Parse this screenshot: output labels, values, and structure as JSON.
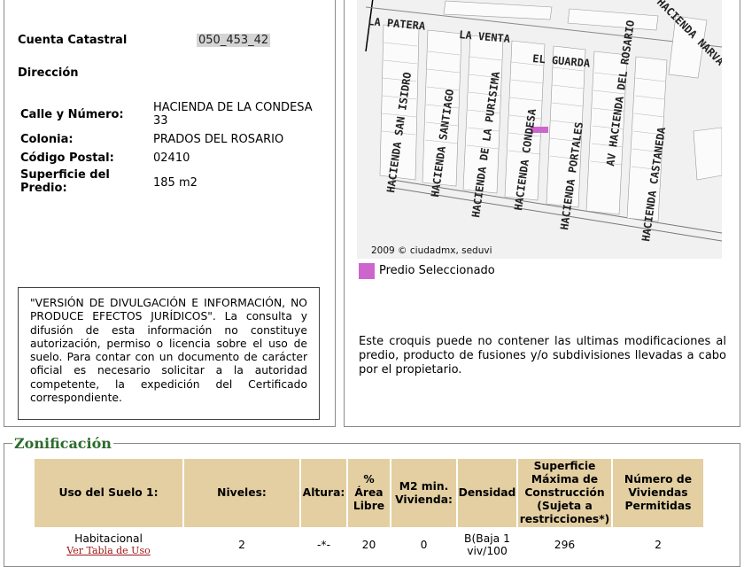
{
  "predio": {
    "cuenta_label": "Cuenta Catastral",
    "cuenta_value": "050_453_42",
    "direccion_label": "Dirección",
    "address": [
      {
        "label": "Calle y Número:",
        "value": "HACIENDA DE LA CONDESA 33"
      },
      {
        "label": "Colonia:",
        "value": "PRADOS DEL ROSARIO"
      },
      {
        "label": "Código Postal:",
        "value": "02410"
      },
      {
        "label": "Superficie del Predio:",
        "value": "185 m2"
      }
    ],
    "disclaimer": "\"VERSIÓN DE DIVULGACIÓN E INFORMACIÓN, NO PRODUCE EFECTOS JURÍDICOS\". La consulta y difusión de esta información no constituye autorización, permiso o licencia sobre el uso de suelo. Para contar con un documento de carácter oficial es necesario solicitar a la autoridad competente, la expedición del Certificado correspondiente."
  },
  "map": {
    "streets": [
      "LA PATERA",
      "LA VENTA",
      "EL GUARDA",
      "HACIENDA NARVA",
      "HACIENDA SAN ISIDRO",
      "HACIENDA SANTIAGO",
      "HACIENDA DE LA PURISIMA",
      "HACIENDA CONDESA",
      "HACIENDA PORTALES",
      "AV HACIENDA DEL ROSARIO",
      "HACIENDA CASTANEDA"
    ],
    "footer": "2009 © ciudadmx, seduvi",
    "legend_label": "Predio Seleccionado",
    "highlight_color": "#cc66cc",
    "note": "Este croquis puede no contener las ultimas modificaciones al predio, producto de fusiones y/o subdivisiones llevadas a cabo por el propietario."
  },
  "zonificacion": {
    "title": "Zonificación",
    "headers": [
      "Uso del Suelo 1:",
      "Niveles:",
      "Altura:",
      "% Área Libre",
      "M2 min. Vivienda:",
      "Densidad",
      "Superficie Máxima de Construcción (Sujeta a restricciones*)",
      "Número de Viviendas Permitidas"
    ],
    "row": {
      "uso": "Habitacional",
      "uso_link": "Ver Tabla de Uso",
      "niveles": "2",
      "altura": "-*-",
      "area_libre": "20",
      "m2_min": "0",
      "densidad": "B(Baja 1 viv/100",
      "superficie": "296",
      "viviendas": "2"
    }
  }
}
